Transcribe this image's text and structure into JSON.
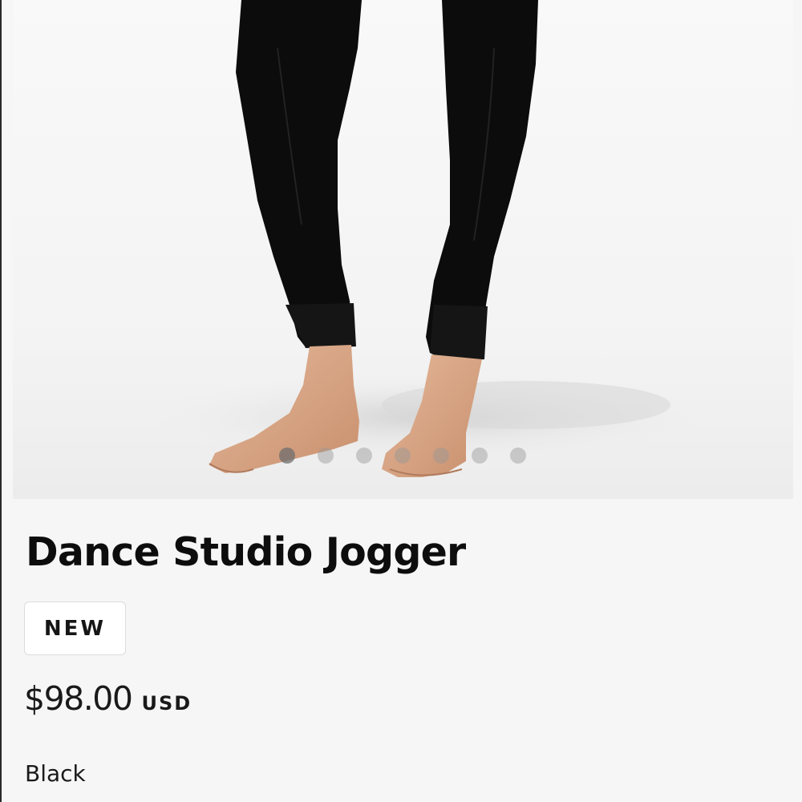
{
  "product": {
    "image_alt": "Black jogger pants worn with bare feet",
    "carousel_dot_count": 7,
    "carousel_active_index": 0,
    "title": "Dance Studio Jogger",
    "badge": "NEW",
    "price": "$98.00",
    "currency": "USD",
    "color_name": "Black"
  }
}
